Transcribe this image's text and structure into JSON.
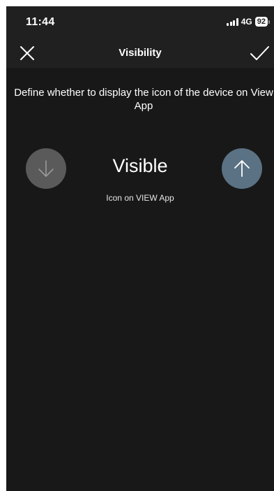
{
  "status_bar": {
    "time": "11:44",
    "network": "4G",
    "battery": "92"
  },
  "nav": {
    "title": "Visibility",
    "close_icon": "close-icon",
    "confirm_icon": "checkmark-icon"
  },
  "content": {
    "description": "Define whether to display the icon of the device on View App",
    "value": "Visible",
    "subtitle": "Icon on VIEW App",
    "down_icon": "arrow-down-icon",
    "up_icon": "arrow-up-icon"
  },
  "colors": {
    "background": "#181818",
    "bar_background": "#202020",
    "down_button": "#5a5a5a",
    "up_button": "#5b7284"
  }
}
